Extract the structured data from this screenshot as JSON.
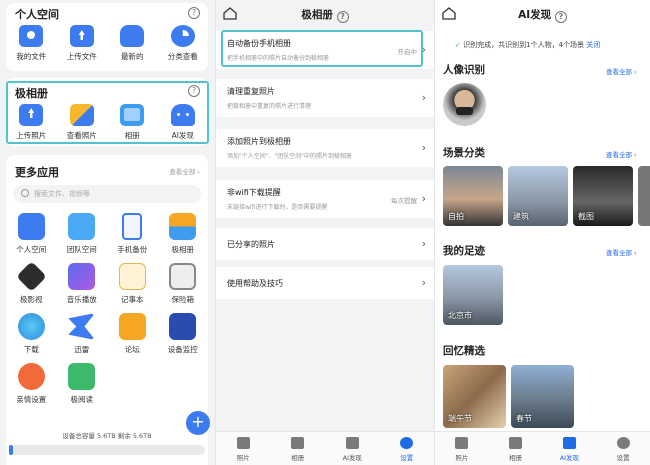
{
  "p1": {
    "personal": {
      "title": "个人空间",
      "items": [
        {
          "label": "我的文件"
        },
        {
          "label": "上传文件"
        },
        {
          "label": "最新的"
        },
        {
          "label": "分类查看"
        }
      ]
    },
    "album": {
      "title": "极相册",
      "items": [
        {
          "label": "上传照片"
        },
        {
          "label": "查看照片"
        },
        {
          "label": "相册"
        },
        {
          "label": "AI发现"
        }
      ]
    },
    "more": {
      "title": "更多应用",
      "view_all": "查看全部 ›",
      "search_placeholder": "搜索文件、视频等",
      "items": [
        {
          "label": "个人空间"
        },
        {
          "label": "团队空间"
        },
        {
          "label": "手机备份"
        },
        {
          "label": "极相册"
        },
        {
          "label": "极影视"
        },
        {
          "label": "音乐播放"
        },
        {
          "label": "记事本"
        },
        {
          "label": "保险箱"
        },
        {
          "label": "下载"
        },
        {
          "label": "迅雷"
        },
        {
          "label": "论坛"
        },
        {
          "label": "设备监控"
        },
        {
          "label": "亲情设置"
        },
        {
          "label": "极阅读"
        }
      ]
    },
    "storage": "设备总容量 5.6TB  剩余 5.6TB",
    "storage_used": 0.02,
    "fab": "+"
  },
  "p2": {
    "title": "极相册",
    "items": [
      {
        "title": "自动备份手机相册",
        "sub": "把手机相册中的照片自动备份到极相册",
        "right": "开启中"
      },
      {
        "title": "清理重复照片",
        "sub": "把极相册中重复的照片进行清理",
        "right": ""
      },
      {
        "title": "添加照片到极相册",
        "sub": "添加\"个人空间\"、\"团队空间\"中的照片到极相册",
        "right": ""
      },
      {
        "title": "非wifi下载提醒",
        "sub": "未链接wifi进行下载时，是否需要提醒",
        "right": "每次提醒"
      },
      {
        "title": "已分享的照片",
        "sub": "",
        "right": ""
      },
      {
        "title": "使用帮助及技巧",
        "sub": "",
        "right": ""
      }
    ],
    "tabs": [
      {
        "label": "照片"
      },
      {
        "label": "相册"
      },
      {
        "label": "AI发现"
      },
      {
        "label": "设置"
      }
    ]
  },
  "p3": {
    "title": "AI发现",
    "notice": "识别完成，共识别到1个人物，4个场景",
    "close": "关闭",
    "portrait": {
      "title": "人像识别",
      "view_all": "查看全部 ›"
    },
    "scene": {
      "title": "场景分类",
      "view_all": "查看全部 ›",
      "items": [
        {
          "label": "自拍"
        },
        {
          "label": "建筑"
        },
        {
          "label": "截图"
        }
      ]
    },
    "footprint": {
      "title": "我的足迹",
      "view_all": "查看全部 ›",
      "items": [
        {
          "label": "北京市"
        }
      ]
    },
    "memory": {
      "title": "回忆精选",
      "items": [
        {
          "label": "端午节"
        },
        {
          "label": "春节"
        }
      ]
    },
    "tabs": [
      {
        "label": "照片"
      },
      {
        "label": "相册"
      },
      {
        "label": "AI发现"
      },
      {
        "label": "设置"
      }
    ]
  },
  "colors": {
    "accent": "#1e6be6",
    "highlight": "#4fc4cf"
  }
}
